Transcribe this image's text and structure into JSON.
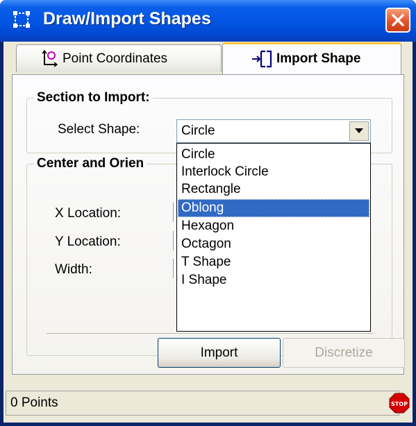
{
  "window": {
    "title": "Draw/Import Shapes"
  },
  "tabs": [
    {
      "label": "Point Coordinates",
      "active": false,
      "icon": "point-coordinates-icon"
    },
    {
      "label": "Import Shape",
      "active": true,
      "icon": "import-shape-icon"
    }
  ],
  "section_import": {
    "legend": "Section to Import:",
    "select_label": "Select Shape:",
    "select_value": "Circle",
    "options": [
      "Circle",
      "Interlock Circle",
      "Rectangle",
      "Oblong",
      "Hexagon",
      "Octagon",
      "T Shape",
      "I Shape"
    ],
    "highlighted": "Oblong"
  },
  "section_center": {
    "legend": "Center and Orien",
    "fields": [
      "X Location:",
      "Y Location:",
      "Width:"
    ]
  },
  "buttons": {
    "import": "Import",
    "discretize": "Discretize"
  },
  "status": {
    "text": "0 Points"
  },
  "colors": {
    "title_bar": "#0255e2",
    "selection": "#316ac5",
    "active_tab_accent": "#ffc83c",
    "close_button": "#e4542c"
  }
}
